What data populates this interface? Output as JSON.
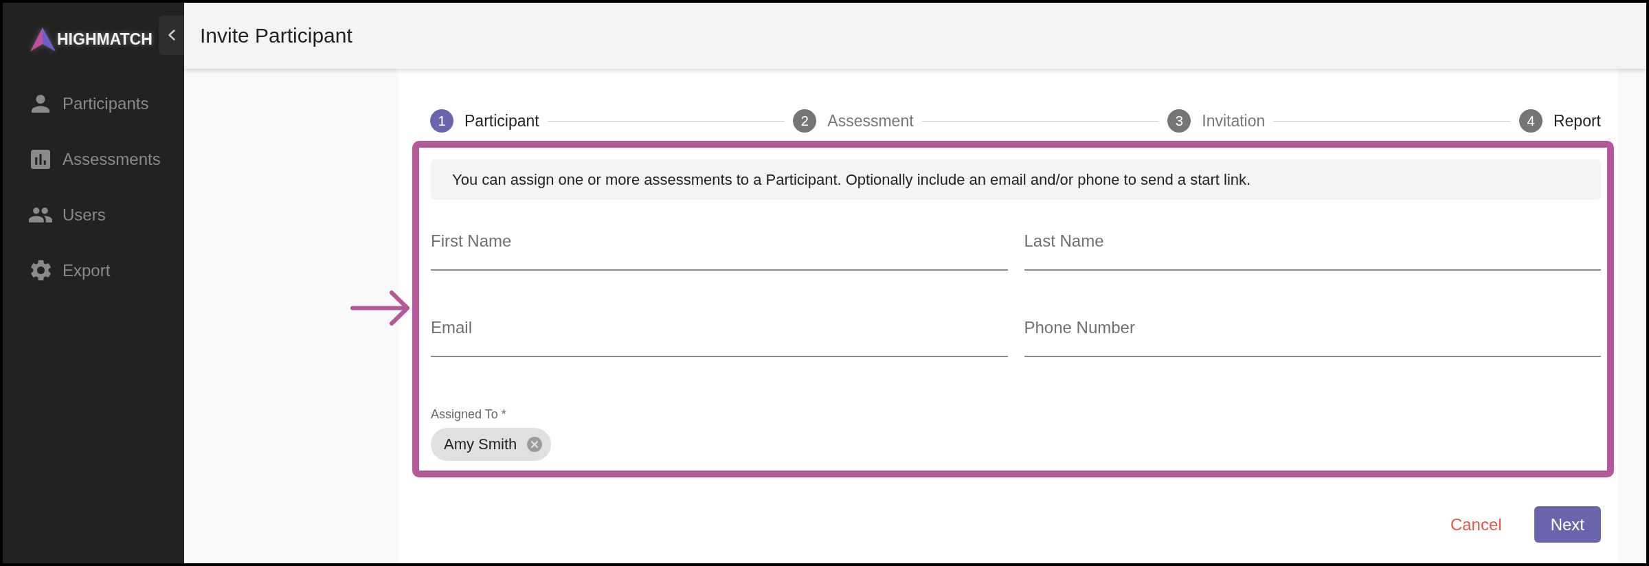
{
  "sidebar": {
    "brand": "HIGHMATCH",
    "items": [
      {
        "label": "Participants",
        "selected": false
      },
      {
        "label": "Assessments",
        "selected": false
      },
      {
        "label": "Users",
        "selected": false
      },
      {
        "label": "Export",
        "selected": false
      }
    ]
  },
  "header": {
    "title": "Invite Participant"
  },
  "stepper": [
    {
      "number": "1",
      "label": "Participant",
      "selected": true,
      "disabled": false
    },
    {
      "number": "2",
      "label": "Assessment",
      "selected": false,
      "disabled": true
    },
    {
      "number": "3",
      "label": "Invitation",
      "selected": false,
      "disabled": true
    },
    {
      "number": "4",
      "label": "Report",
      "selected": false,
      "disabled": false
    }
  ],
  "form": {
    "info": "You can assign one or more assessments to a Participant. Optionally include an email and/or phone to send a start link.",
    "fields": [
      {
        "label": "First Name"
      },
      {
        "label": "Last Name"
      },
      {
        "label": "Email"
      },
      {
        "label": "Phone Number"
      }
    ],
    "assigned_to": {
      "label": "Assigned To *",
      "chips": [
        "Amy Smith"
      ]
    }
  },
  "buttons": [
    {
      "label": "Cancel",
      "kind": "text"
    },
    {
      "label": "Next",
      "kind": "contained"
    }
  ]
}
